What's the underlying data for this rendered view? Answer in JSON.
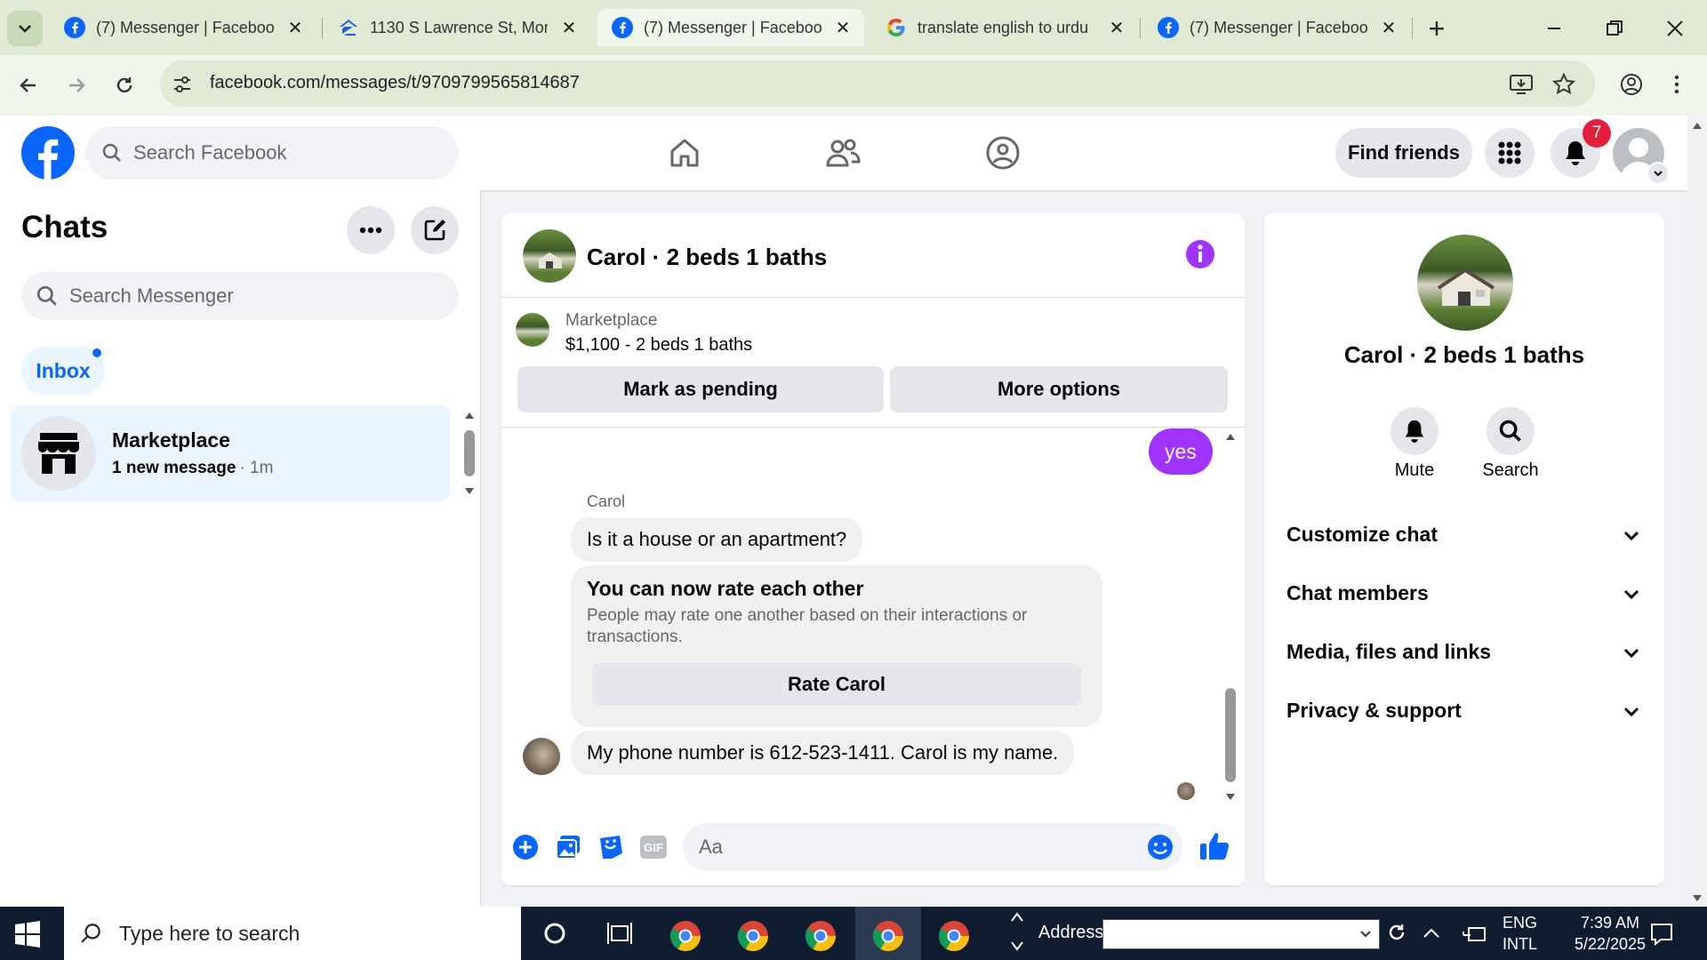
{
  "browser": {
    "tabs": [
      {
        "title": "(7) Messenger | Facebook",
        "active": false,
        "icon": "facebook-icon"
      },
      {
        "title": "1130 S Lawrence St, Mon",
        "active": false,
        "icon": "zillow-icon"
      },
      {
        "title": "(7) Messenger | Facebook",
        "active": true,
        "icon": "facebook-icon"
      },
      {
        "title": "translate english to urdu",
        "active": false,
        "icon": "google-icon"
      },
      {
        "title": "(7) Messenger | Facebook",
        "active": false,
        "icon": "facebook-icon"
      }
    ],
    "url": "facebook.com/messages/t/9709799565814687"
  },
  "fb_header": {
    "search_placeholder": "Search Facebook",
    "find_friends": "Find friends",
    "notification_count": "7",
    "brand_color": "#0866ff"
  },
  "chats": {
    "title": "Chats",
    "search_placeholder": "Search Messenger",
    "filter": "Inbox",
    "items": [
      {
        "name": "Marketplace",
        "preview": "1 new message",
        "time": "· 1m"
      }
    ]
  },
  "conversation": {
    "title": "Carol · 2 beds 1 baths",
    "listing": {
      "source": "Marketplace",
      "price_title": "$1,100 - 2 beds 1 baths",
      "mark_pending": "Mark as pending",
      "more_options": "More options"
    },
    "messages": {
      "outgoing_yes": "yes",
      "sender_name": "Carol",
      "question": "Is it a house or an apartment?",
      "rate_title": "You can now rate each other",
      "rate_desc": "People may rate one another based on their interactions or transactions.",
      "rate_button": "Rate Carol",
      "phone_msg": "My phone number is 612-523-1411. Carol is my name."
    },
    "composer_placeholder": "Aa",
    "accent_color": "#a033ff"
  },
  "details": {
    "name": "Carol · 2 beds 1 baths",
    "mute": "Mute",
    "search": "Search",
    "sections": [
      "Customize chat",
      "Chat members",
      "Media, files and links",
      "Privacy & support"
    ]
  },
  "taskbar": {
    "search_placeholder": "Type here to search",
    "address_label": "Address",
    "lang1": "ENG",
    "lang2": "INTL",
    "time": "7:39 AM",
    "date": "5/22/2025"
  }
}
